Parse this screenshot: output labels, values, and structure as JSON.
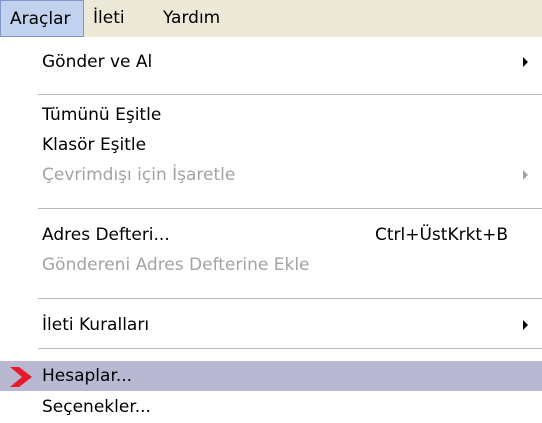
{
  "menubar": {
    "items": [
      {
        "label": "Araçlar"
      },
      {
        "label": "İleti"
      },
      {
        "label": "Yardım"
      }
    ]
  },
  "menu": {
    "items": [
      {
        "label": "Gönder ve Al",
        "has_submenu": true
      },
      {
        "label": "Tümünü Eşitle"
      },
      {
        "label": "Klasör Eşitle"
      },
      {
        "label": "Çevrimdışı için İşaretle",
        "disabled": true,
        "has_submenu": true
      },
      {
        "label": "Adres Defteri...",
        "shortcut": "Ctrl+ÜstKrkt+B"
      },
      {
        "label": "Göndereni Adres Defterine Ekle",
        "disabled": true
      },
      {
        "label": "İleti Kuralları",
        "has_submenu": true
      },
      {
        "label": "Hesaplar...",
        "highlighted": true,
        "icon": "red-chevron-pointer-icon"
      },
      {
        "label": "Seçenekler..."
      }
    ]
  },
  "colors": {
    "menubar_bg": "#ece9d8",
    "active_menu_bg": "#c1d2ee",
    "highlight_bg": "#b9b8d2",
    "disabled_text": "#a3a3a3",
    "pointer_red": "#e8192c"
  }
}
